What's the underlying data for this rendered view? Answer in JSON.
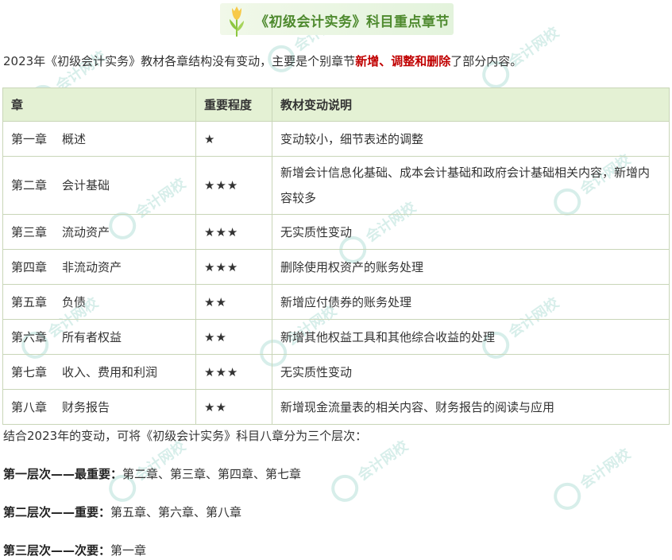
{
  "title": "《初级会计实务》科目重点章节",
  "intro": {
    "prefix": "2023年《初级会计实务》教材各章结构没有变动，主要是个别章节",
    "highlight": "新增、调整和删除",
    "suffix": "了部分内容。"
  },
  "table": {
    "headers": [
      "章",
      "重要程度",
      "教材变动说明"
    ],
    "rows": [
      {
        "num": "第一章",
        "name": "概述",
        "stars": "★",
        "desc": "变动较小，细节表述的调整"
      },
      {
        "num": "第二章",
        "name": "会计基础",
        "stars": "★★★",
        "desc": "新增会计信息化基础、成本会计基础和政府会计基础相关内容，新增内容较多"
      },
      {
        "num": "第三章",
        "name": "流动资产",
        "stars": "★★★",
        "desc": "无实质性变动"
      },
      {
        "num": "第四章",
        "name": "非流动资产",
        "stars": "★★★",
        "desc": "删除使用权资产的账务处理"
      },
      {
        "num": "第五章",
        "name": "负债",
        "stars": "★★",
        "desc": "新增应付债券的账务处理"
      },
      {
        "num": "第六章",
        "name": "所有者权益",
        "stars": "★★",
        "desc": "新增其他权益工具和其他综合收益的处理"
      },
      {
        "num": "第七章",
        "name": "收入、费用和利润",
        "stars": "★★★",
        "desc": "无实质性变动"
      },
      {
        "num": "第八章",
        "name": "财务报告",
        "stars": "★★",
        "desc": "新增现金流量表的相关内容、财务报告的阅读与应用"
      }
    ]
  },
  "summary": "结合2023年的变动，可将《初级会计实务》科目八章分为三个层次：",
  "levels": [
    {
      "label": "第一层次——最重要：",
      "chapters": "第二章、第三章、第四章、第七章"
    },
    {
      "label": "第二层次——重要：",
      "chapters": "第五章、第六章、第八章"
    },
    {
      "label": "第三层次——次要：",
      "chapters": "第一章"
    }
  ],
  "watermark_text": "会计网校",
  "colors": {
    "title_green": "#4e8a2e",
    "highlight_red": "#c00000",
    "header_bg": "#e4f1d4",
    "border": "#c9d6b8",
    "watermark": "#8fd0c4"
  },
  "icons": {
    "title_icon": "tulip-icon"
  }
}
